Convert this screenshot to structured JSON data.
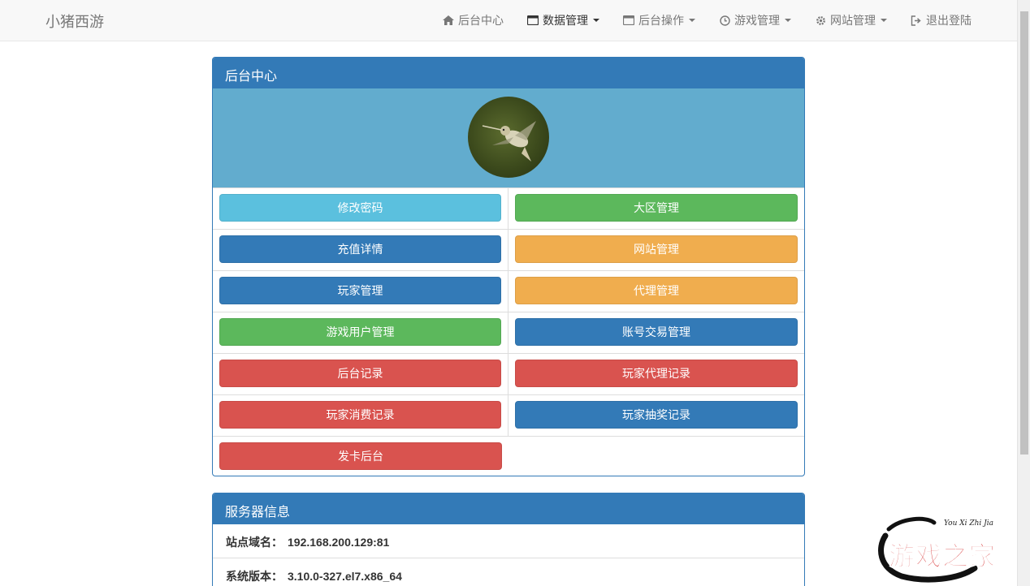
{
  "navbar": {
    "brand": "小猪西游",
    "items": [
      {
        "label": "后台中心",
        "icon": "home-icon",
        "dropdown": false
      },
      {
        "label": "数据管理",
        "icon": "window-icon",
        "dropdown": true
      },
      {
        "label": "后台操作",
        "icon": "window-icon",
        "dropdown": true
      },
      {
        "label": "游戏管理",
        "icon": "clock-icon",
        "dropdown": true
      },
      {
        "label": "网站管理",
        "icon": "gear-icon",
        "dropdown": true
      },
      {
        "label": "退出登陆",
        "icon": "logout-icon",
        "dropdown": false
      }
    ]
  },
  "main_panel": {
    "title": "后台中心",
    "buttons": [
      {
        "label": "修改密码",
        "style": "info"
      },
      {
        "label": "大区管理",
        "style": "success"
      },
      {
        "label": "充值详情",
        "style": "primary"
      },
      {
        "label": "网站管理",
        "style": "warning"
      },
      {
        "label": "玩家管理",
        "style": "primary"
      },
      {
        "label": "代理管理",
        "style": "warning"
      },
      {
        "label": "游戏用户管理",
        "style": "success"
      },
      {
        "label": "账号交易管理",
        "style": "primary"
      },
      {
        "label": "后台记录",
        "style": "danger"
      },
      {
        "label": "玩家代理记录",
        "style": "danger"
      },
      {
        "label": "玩家消费记录",
        "style": "danger"
      },
      {
        "label": "玩家抽奖记录",
        "style": "primary"
      },
      {
        "label": "发卡后台",
        "style": "danger"
      }
    ]
  },
  "server_panel": {
    "title": "服务器信息",
    "rows": [
      {
        "label": "站点域名：",
        "value": "192.168.200.129:81"
      },
      {
        "label": "系统版本：",
        "value": "3.10.0-327.el7.x86_64"
      }
    ]
  },
  "watermark": {
    "text": "游戏之家",
    "sub": "You Xi Zhi Jia"
  },
  "colors": {
    "primary": "#337ab7",
    "info": "#5bc0de",
    "success": "#5cb85c",
    "warning": "#f0ad4e",
    "danger": "#d9534f",
    "banner": "#62acce"
  }
}
